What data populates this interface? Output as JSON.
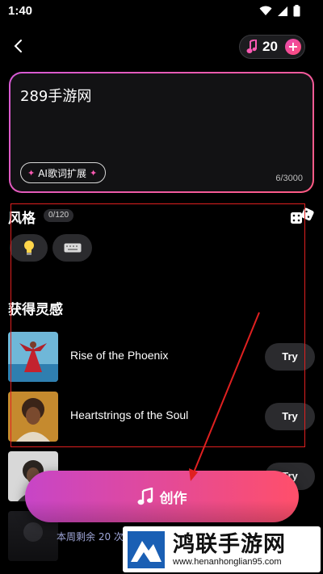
{
  "status": {
    "time": "1:40"
  },
  "header": {
    "credits": "20",
    "plus": "+"
  },
  "prompt": {
    "text": "289手游网",
    "ai_expand_label": "AI歌词扩展",
    "char_count": "6/3000"
  },
  "style_section": {
    "title": "风格",
    "count": "0/120",
    "chips": [
      {
        "icon": "lightbulb-icon"
      },
      {
        "icon": "keyboard-icon"
      }
    ]
  },
  "inspiration": {
    "title": "获得灵感",
    "songs": [
      {
        "title": "Rise of the Phoenix",
        "try_label": "Try"
      },
      {
        "title": "Heartstrings of the Soul",
        "try_label": "Try"
      },
      {
        "title": "",
        "try_label": "Try"
      }
    ]
  },
  "create_button": {
    "label": "创作"
  },
  "footer": {
    "remaining": "本周剩余 20 次"
  },
  "watermark": {
    "title": "鸿联手游网",
    "url": "www.henanhonglian95.com"
  },
  "colors": {
    "accent_start": "#c745c7",
    "accent_end": "#ff4f6a",
    "annotation": "#e02020"
  }
}
